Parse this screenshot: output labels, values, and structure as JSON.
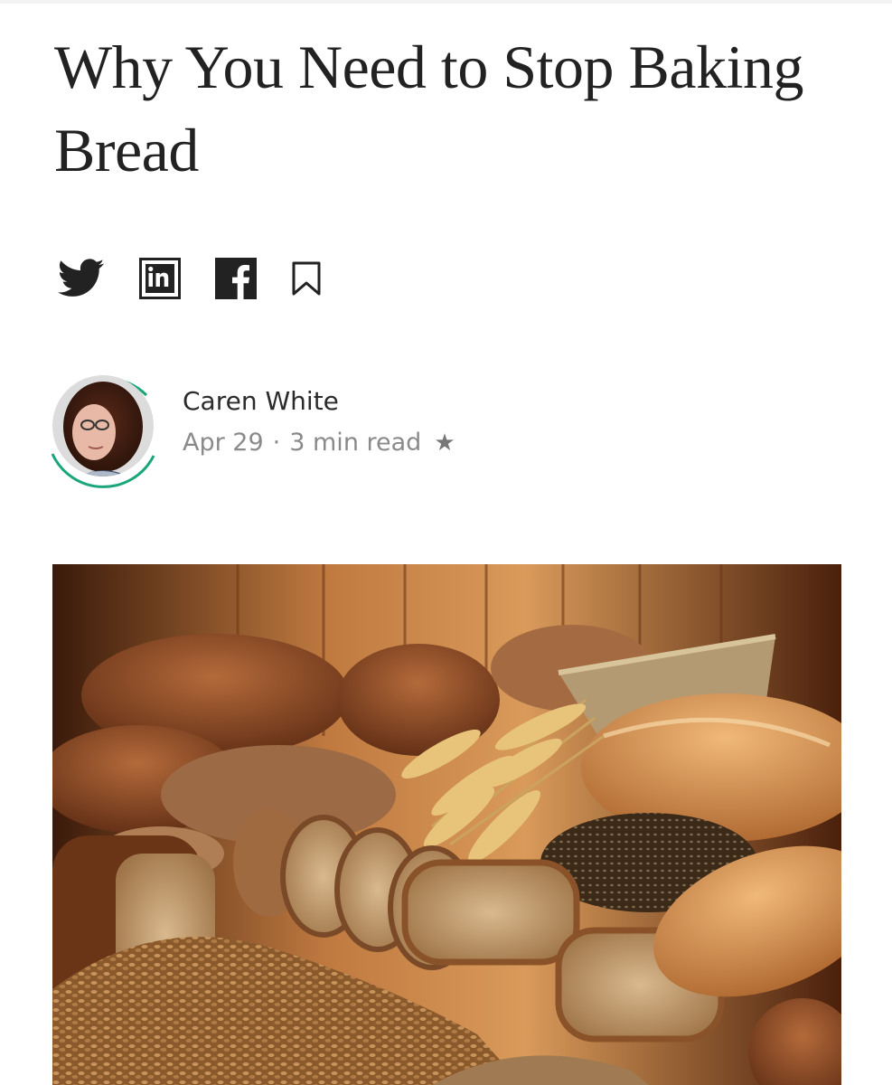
{
  "article": {
    "title": "Why You Need to Stop Baking Bread"
  },
  "share": {
    "icons": [
      "twitter-icon",
      "linkedin-icon",
      "facebook-icon",
      "bookmark-icon"
    ],
    "icon_color": "#222222"
  },
  "author": {
    "name": "Caren White",
    "date": "Apr 29",
    "separator": "·",
    "read_time": "3 min read",
    "member_star": "★",
    "ring_color": "#1aa67a"
  },
  "hero_image": {
    "subject": "bread-loaves-and-wheat-photo"
  }
}
